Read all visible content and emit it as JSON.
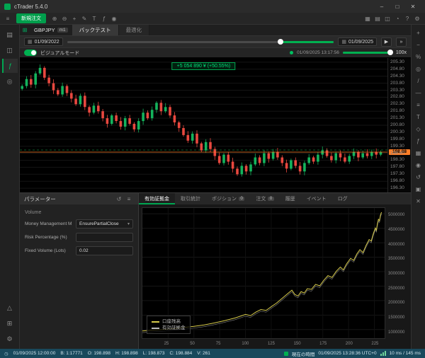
{
  "window": {
    "title": "cTrader 5.4.0",
    "controls": [
      {
        "name": "minimize-button",
        "glyph": "–"
      },
      {
        "name": "maximize-button",
        "glyph": "□"
      },
      {
        "name": "close-button",
        "glyph": "✕"
      }
    ]
  },
  "menubar": {
    "menu_icon": {
      "name": "menu-icon",
      "glyph": "≡"
    },
    "new_order_label": "新規注文",
    "tool_icons": [
      {
        "name": "zoom-in-icon",
        "glyph": "⊕"
      },
      {
        "name": "zoom-out-icon",
        "glyph": "⊖"
      },
      {
        "name": "crosshair-icon",
        "glyph": "+"
      },
      {
        "name": "draw-icon",
        "glyph": "✎"
      },
      {
        "name": "text-icon",
        "glyph": "T"
      },
      {
        "name": "indicator-icon",
        "glyph": "ƒ"
      },
      {
        "name": "snapshot-icon",
        "glyph": "◉"
      }
    ],
    "right_icons": [
      {
        "name": "layout-grid-icon",
        "glyph": "▦"
      },
      {
        "name": "panels-icon",
        "glyph": "▤"
      },
      {
        "name": "workspace-icon",
        "glyph": "◫"
      },
      {
        "name": "notifications-icon",
        "glyph": "◔"
      },
      {
        "name": "help-icon",
        "glyph": "?"
      },
      {
        "name": "settings-icon",
        "glyph": "⚙"
      }
    ]
  },
  "left_rail": {
    "top": [
      {
        "name": "watchlist-icon",
        "glyph": "▤"
      },
      {
        "name": "charts-icon",
        "glyph": "◫"
      },
      {
        "name": "algo-icon",
        "glyph": "ƒ",
        "active": true
      },
      {
        "name": "search-icon",
        "glyph": "◎"
      }
    ],
    "bottom": [
      {
        "name": "alerts-icon",
        "glyph": "△"
      },
      {
        "name": "plugins-icon",
        "glyph": "⊞"
      },
      {
        "name": "settings-icon",
        "glyph": "⚙"
      }
    ]
  },
  "right_rail": {
    "icons": [
      {
        "name": "zoom-in-icon",
        "glyph": "+"
      },
      {
        "name": "zoom-out-icon",
        "glyph": "−"
      },
      {
        "name": "percent-icon",
        "glyph": "%"
      },
      {
        "name": "crosshair-icon",
        "glyph": "◎"
      },
      {
        "name": "trendline-icon",
        "glyph": "/"
      },
      {
        "name": "horizontal-line-icon",
        "glyph": "—"
      },
      {
        "name": "fibonacci-icon",
        "glyph": "≡"
      },
      {
        "name": "text-tool-icon",
        "glyph": "T"
      },
      {
        "name": "shapes-icon",
        "glyph": "◇"
      },
      {
        "name": "indicator-icon",
        "glyph": "ƒ"
      },
      {
        "name": "grid-icon",
        "glyph": "▦"
      },
      {
        "name": "camera-icon",
        "glyph": "◉"
      },
      {
        "name": "undo-icon",
        "glyph": "↺"
      },
      {
        "name": "lock-icon",
        "glyph": "▣"
      },
      {
        "name": "delete-icon",
        "glyph": "✕"
      }
    ]
  },
  "chart_tabs": {
    "leading_icon": {
      "name": "new-chart-icon",
      "glyph": "⊞"
    },
    "symbol": "GBPJPY",
    "timeframe": "m1",
    "tabs": [
      {
        "name": "tab-backtest",
        "label": "バックテスト",
        "active": true
      },
      {
        "name": "tab-optimization",
        "label": "最適化",
        "active": false
      }
    ]
  },
  "playback": {
    "start_date": "01/09/2022",
    "end_date": "01/09/2025",
    "progress_percent": 80,
    "play_glyph": "▶",
    "fast_forward_glyph": "»",
    "calendar_glyph": "▦"
  },
  "visual": {
    "label": "ビジュアルモード",
    "enabled": true,
    "timestamp": "01/09/2025 13:17:56",
    "speed_label": "100x",
    "speed_percent": 100
  },
  "chart": {
    "tooltip": "+5 054 890 ¥ (+50.55%)",
    "price_min": 196.0,
    "price_max": 205.6,
    "axis_labels": [
      "205.30",
      "204.80",
      "204.30",
      "203.80",
      "203.30",
      "202.80",
      "202.30",
      "201.80",
      "201.30",
      "200.80",
      "200.30",
      "199.80",
      "199.30",
      "198.80",
      "198.30",
      "197.80",
      "197.30",
      "196.80",
      "196.30"
    ],
    "current_price": "198.88",
    "current_price_value": 198.88,
    "up_color": "#14b35c",
    "down_color": "#e8483f",
    "line_color": "#ff7e27",
    "closes": [
      203.6,
      204.1,
      203.7,
      204.5,
      204.9,
      204.2,
      203.8,
      203.3,
      203.0,
      203.6,
      203.1,
      202.7,
      202.3,
      202.9,
      202.1,
      201.7,
      202.2,
      201.8,
      201.3,
      200.9,
      201.5,
      201.1,
      200.7,
      201.3,
      200.9,
      200.5,
      201.1,
      201.7,
      201.3,
      201.9,
      202.4,
      201.8,
      202.1,
      201.5,
      201.0,
      200.6,
      200.1,
      199.7,
      200.2,
      199.5,
      199.0,
      199.6,
      199.1,
      198.6,
      198.1,
      198.7,
      198.2,
      197.7,
      197.3,
      197.9,
      197.5,
      198.0,
      198.5,
      198.1,
      198.8,
      198.4,
      198.9,
      198.5,
      198.1,
      197.7,
      198.3,
      197.9,
      197.5,
      198.1,
      198.5,
      198.2,
      198.7,
      199.0,
      198.6,
      198.3,
      198.8,
      198.5,
      198.2,
      198.6,
      198.9,
      198.5,
      198.8,
      198.6,
      198.9,
      198.7,
      198.88
    ]
  },
  "params_panel": {
    "title": "パラメーター",
    "header_icons": [
      {
        "name": "refresh-icon",
        "glyph": "↺"
      },
      {
        "name": "panel-menu-icon",
        "glyph": "≡"
      }
    ],
    "section": "Volume",
    "rows": [
      {
        "name": "param-money-management",
        "label": "Money Management M",
        "value": "EnsurePartialClose",
        "type": "dropdown"
      },
      {
        "name": "param-risk-percentage",
        "label": "Risk Percentage (%)",
        "value": "",
        "type": "input"
      },
      {
        "name": "param-fixed-volume",
        "label": "Fixed Volume (Lots)",
        "value": "0.02",
        "type": "input"
      }
    ]
  },
  "results_panel": {
    "tabs": [
      {
        "name": "tab-equity",
        "label": "有効証拠金",
        "active": true
      },
      {
        "name": "tab-statistics",
        "label": "取引統計"
      },
      {
        "name": "tab-positions",
        "label": "ポジション",
        "badge": "0"
      },
      {
        "name": "tab-orders",
        "label": "注文",
        "badge": "0"
      },
      {
        "name": "tab-history",
        "label": "履歴"
      },
      {
        "name": "tab-events",
        "label": "イベント"
      },
      {
        "name": "tab-log",
        "label": "ログ"
      }
    ],
    "equity": {
      "line_color": "#d6ca4a",
      "secondary_color": "#b9b9b9",
      "y_min": 700000,
      "y_max": 5200000,
      "x_min": 0,
      "x_max": 235,
      "y_ticks": [
        5000000,
        4500000,
        4000000,
        3500000,
        3000000,
        2500000,
        2000000,
        1500000,
        1000000
      ],
      "x_ticks": [
        25,
        50,
        75,
        100,
        125,
        150,
        175,
        200,
        225
      ],
      "points": [
        [
          0,
          950000
        ],
        [
          10,
          980000
        ],
        [
          20,
          1000000
        ],
        [
          30,
          1030000
        ],
        [
          40,
          1070000
        ],
        [
          50,
          1110000
        ],
        [
          60,
          1160000
        ],
        [
          70,
          1230000
        ],
        [
          80,
          1310000
        ],
        [
          90,
          1400000
        ],
        [
          100,
          1520000
        ],
        [
          105,
          1480000
        ],
        [
          110,
          1600000
        ],
        [
          115,
          1690000
        ],
        [
          120,
          1660000
        ],
        [
          125,
          1790000
        ],
        [
          130,
          1910000
        ],
        [
          135,
          2060000
        ],
        [
          140,
          2210000
        ],
        [
          145,
          2360000
        ],
        [
          148,
          2210000
        ],
        [
          151,
          2160000
        ],
        [
          154,
          2310000
        ],
        [
          157,
          2260000
        ],
        [
          160,
          2410000
        ],
        [
          164,
          2390000
        ],
        [
          168,
          2560000
        ],
        [
          172,
          2510000
        ],
        [
          176,
          2700000
        ],
        [
          180,
          2860000
        ],
        [
          184,
          2800000
        ],
        [
          188,
          3010000
        ],
        [
          192,
          3160000
        ],
        [
          195,
          3060000
        ],
        [
          198,
          3260000
        ],
        [
          202,
          3460000
        ],
        [
          205,
          3390000
        ],
        [
          208,
          3610000
        ],
        [
          211,
          3760000
        ],
        [
          214,
          3660000
        ],
        [
          217,
          3910000
        ],
        [
          220,
          4110000
        ],
        [
          222,
          4060000
        ],
        [
          224,
          4310000
        ],
        [
          226,
          4510000
        ],
        [
          227,
          4430000
        ],
        [
          228,
          4660000
        ],
        [
          229,
          4810000
        ],
        [
          230,
          4760000
        ],
        [
          231,
          4960000
        ],
        [
          232,
          5054890
        ]
      ],
      "legend": [
        {
          "label": "口座残高",
          "color": "#d6ca4a"
        },
        {
          "label": "有効証拠金",
          "color": "#b9b9b9"
        }
      ]
    }
  },
  "statusbar": {
    "left_items": [
      "01/09/2025 12:00:00",
      "B: 1:17771",
      "O: 198.898",
      "H: 198.898",
      "L: 198.873",
      "C: 198.884",
      "V: 261"
    ],
    "current_time_label": "現在の時間",
    "current_time": "01/09/2025 13:28:36 UTC+0",
    "latency": "10 ms / 145 ms"
  }
}
